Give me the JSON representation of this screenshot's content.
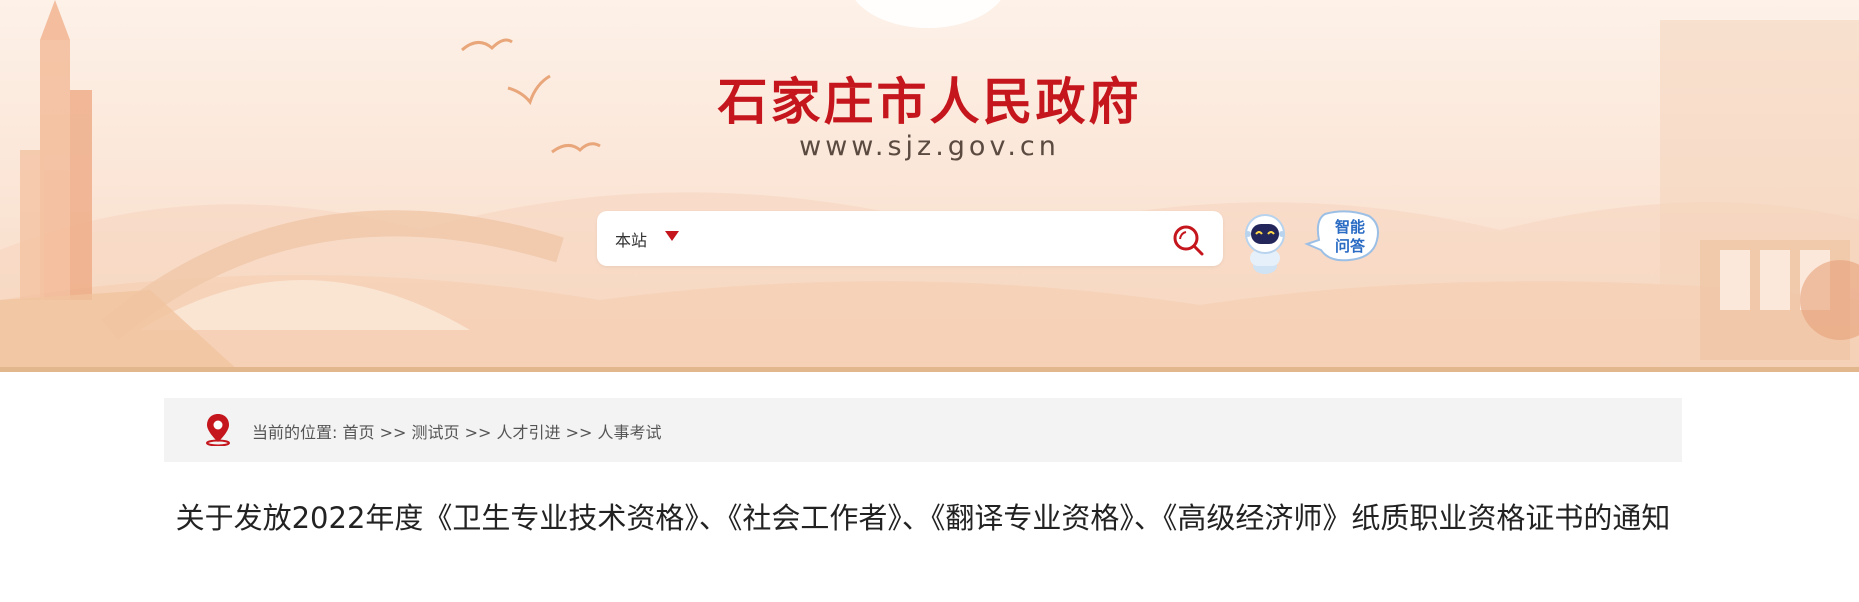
{
  "header": {
    "site_title": "石家庄市人民政府",
    "domain": "www.sjz.gov.cn"
  },
  "search": {
    "scope_label": "本站",
    "placeholder": ""
  },
  "assistant": {
    "bubble_line1": "智能",
    "bubble_line2": "问答"
  },
  "breadcrumb": {
    "prefix": "当前的位置:",
    "items": [
      "首页",
      "测试页",
      "人才引进",
      "人事考试"
    ],
    "separator": ">>"
  },
  "article": {
    "title": "关于发放2022年度《卫生专业技术资格》、《社会工作者》、《翻译专业资格》、《高级经济师》纸质职业资格证书的通知"
  },
  "colors": {
    "brand_red": "#c4161c",
    "banner_bg": "#fbe7d9",
    "breadcrumb_bg": "#f3f3f3"
  }
}
